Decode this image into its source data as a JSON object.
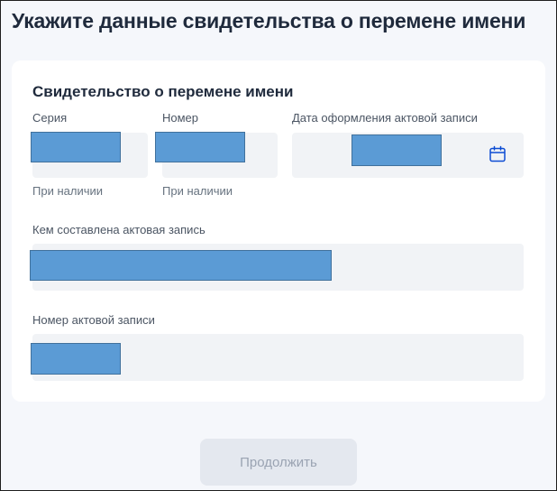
{
  "page": {
    "title": "Укажите данные свидетельства о перемене имени"
  },
  "form": {
    "heading": "Свидетельство о перемене имени",
    "series": {
      "label": "Серия",
      "hint": "При наличии",
      "value": ""
    },
    "number": {
      "label": "Номер",
      "hint": "При наличии",
      "value": ""
    },
    "record_date": {
      "label": "Дата оформления актовой записи",
      "value": "",
      "icon": "calendar-icon"
    },
    "issued_by": {
      "label": "Кем составлена актовая запись",
      "value": ""
    },
    "record_number": {
      "label": "Номер актовой записи",
      "value": ""
    }
  },
  "actions": {
    "continue_label": "Продолжить",
    "continue_disabled": true
  },
  "colors": {
    "redaction": "#5b9bd5",
    "field_bg": "#f1f3f6",
    "accent": "#0d4cd3"
  }
}
